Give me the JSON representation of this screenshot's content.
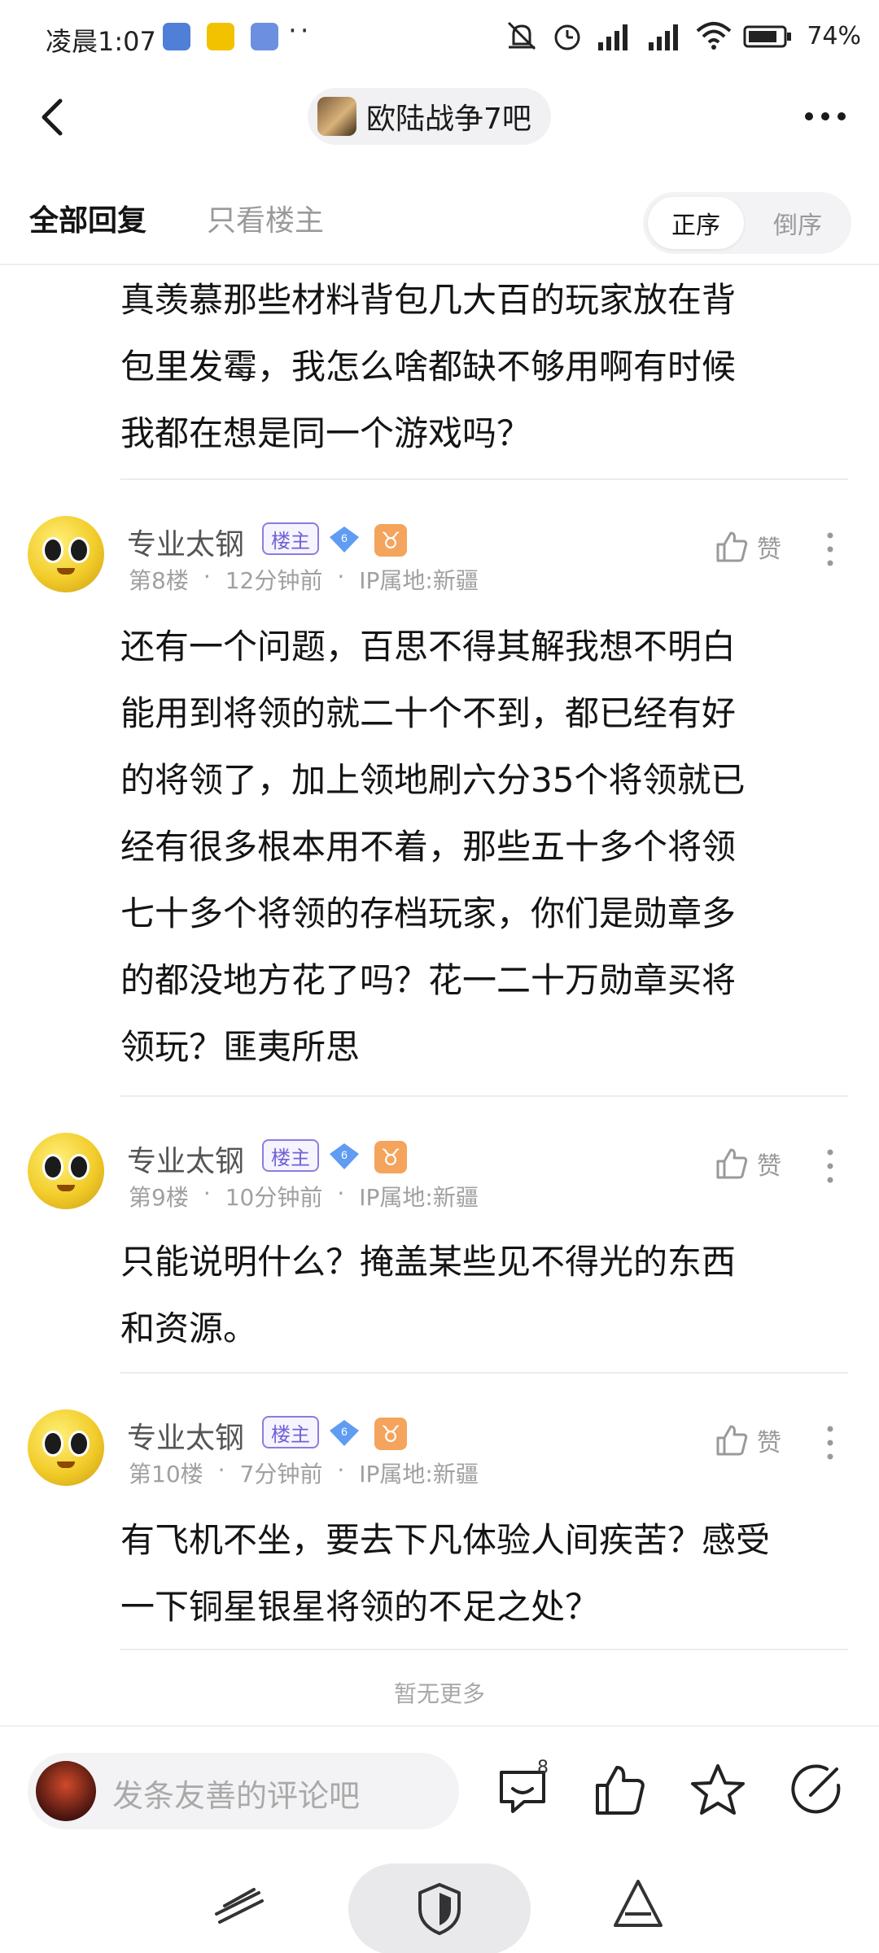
{
  "status_bar": {
    "time": "凌晨1:07",
    "dots": "··",
    "battery": "74%",
    "icons": [
      "app-icon",
      "meituan-icon",
      "mail-icon",
      "mute-icon",
      "alarm-icon",
      "signal-icon",
      "signal-icon",
      "wifi-icon",
      "battery-icon"
    ]
  },
  "header": {
    "forum_name": "欧陆战争7吧"
  },
  "tabs": {
    "all_replies": "全部回复",
    "op_only": "只看楼主",
    "sort_asc": "正序",
    "sort_desc": "倒序"
  },
  "top_partial_post": {
    "lines": [
      "真羡慕那些材料背包几大百的玩家放在背",
      "包里发霉，我怎么啥都缺不够用啊有时候",
      "我都在想是同一个游戏吗？"
    ]
  },
  "replies": [
    {
      "username": "专业太钢",
      "badge": "楼主",
      "level": "6",
      "zodiac": "♉",
      "floor": "第8楼",
      "time": "12分钟前",
      "ip": "IP属地:新疆",
      "like_label": "赞",
      "lines": [
        "还有一个问题，百思不得其解我想不明白",
        "能用到将领的就二十个不到，都已经有好",
        "的将领了，加上领地刷六分35个将领就已",
        "经有很多根本用不着，那些五十多个将领",
        "七十多个将领的存档玩家，你们是勋章多",
        "的都没地方花了吗？花一二十万勋章买将",
        "领玩？匪夷所思"
      ]
    },
    {
      "username": "专业太钢",
      "badge": "楼主",
      "level": "6",
      "zodiac": "♉",
      "floor": "第9楼",
      "time": "10分钟前",
      "ip": "IP属地:新疆",
      "like_label": "赞",
      "lines": [
        "只能说明什么？掩盖某些见不得光的东西",
        "和资源。"
      ]
    },
    {
      "username": "专业太钢",
      "badge": "楼主",
      "level": "6",
      "zodiac": "♉",
      "floor": "第10楼",
      "time": "7分钟前",
      "ip": "IP属地:新疆",
      "like_label": "赞",
      "lines": [
        "有飞机不坐，要去下凡体验人间疾苦？感受",
        "一下铜星银星将领的不足之处？"
      ]
    }
  ],
  "no_more": "暂无更多",
  "comment_bar": {
    "placeholder": "发条友善的评论吧",
    "comment_count": "8"
  }
}
